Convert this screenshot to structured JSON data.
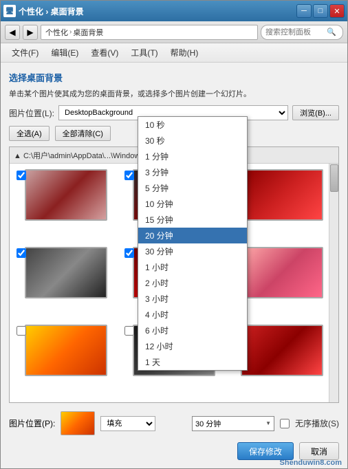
{
  "window": {
    "title": "个性化 › 桌面背景",
    "icon": "🖥"
  },
  "titlebar": {
    "minimize": "─",
    "maximize": "□",
    "close": "✕"
  },
  "addressbar": {
    "back_label": "◀",
    "forward_label": "▶",
    "breadcrumb": [
      "个性化",
      "›",
      "桌面背景"
    ],
    "search_placeholder": "搜索控制面板"
  },
  "menu": {
    "items": [
      "文件(F)",
      "编辑(E)",
      "查看(V)",
      "工具(T)",
      "帮助(H)"
    ]
  },
  "content": {
    "title": "选择桌面背景",
    "desc": "单击某个图片使其成为您的桌面背景，或选择多个图片创建一个幻灯片。",
    "location_label": "图片位置(L):",
    "location_value": "DesktopBackground",
    "browse_label": "浏览(B)...",
    "select_all_label": "全选(A)",
    "clear_all_label": "全部清除(C)",
    "path_text": "▲ C:\\用户\\admin\\AppData\\...\\Windows\\Th... (10)"
  },
  "wallpapers": [
    {
      "id": 1,
      "checked": true,
      "style": "thumb-rose"
    },
    {
      "id": 2,
      "checked": true,
      "style": "thumb-dark-flower"
    },
    {
      "id": 3,
      "checked": true,
      "style": "thumb-right1"
    },
    {
      "id": 4,
      "checked": true,
      "style": "thumb-black-white"
    },
    {
      "id": 5,
      "checked": true,
      "style": "thumb-dark-red"
    },
    {
      "id": 6,
      "checked": false,
      "style": "thumb-pink-rose"
    },
    {
      "id": 7,
      "checked": false,
      "style": "thumb-flower2"
    },
    {
      "id": 8,
      "checked": false,
      "style": "thumb-fourth"
    },
    {
      "id": 9,
      "checked": false,
      "style": "thumb-red-flower"
    }
  ],
  "position": {
    "label": "图片位置(P):",
    "value": "填充"
  },
  "interval": {
    "label": "",
    "current_display": "30 分钟",
    "options": [
      "10 秒",
      "30 秒",
      "1 分钟",
      "3 分钟",
      "5 分钟",
      "10 分钟",
      "15 分钟",
      "20 分钟",
      "30 分钟",
      "1 小时",
      "2 小时",
      "3 小时",
      "4 小时",
      "6 小时",
      "12 小时",
      "1 天"
    ],
    "selected": "20 分钟"
  },
  "shuffle": {
    "label": "无序播放(S)",
    "checked": false
  },
  "buttons": {
    "save": "保存修改",
    "cancel": "取消"
  },
  "watermark": "Shenduwin8.com"
}
